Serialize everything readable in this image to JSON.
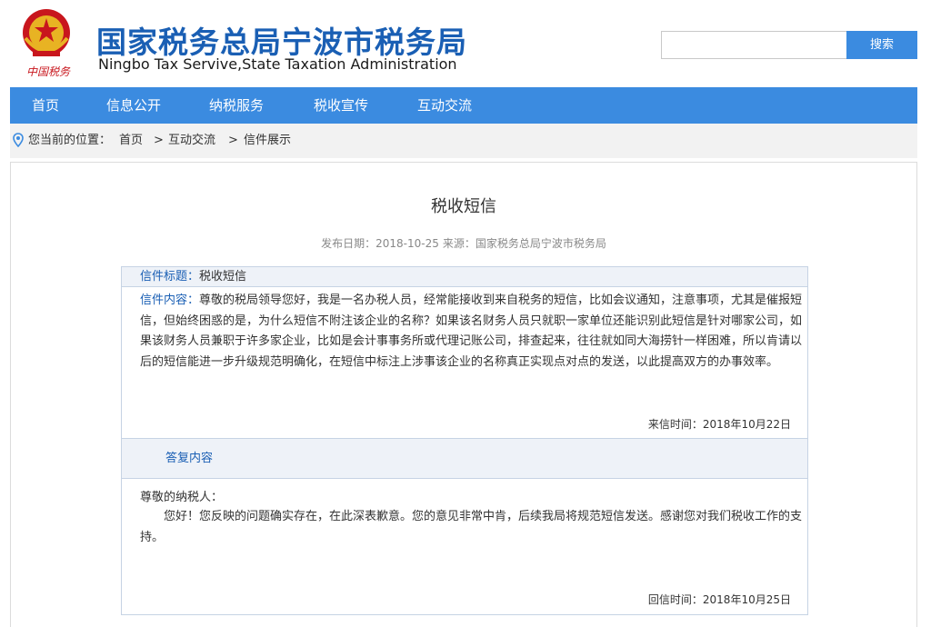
{
  "header": {
    "emblem_text": "中国税务",
    "site_title": "国家税务总局宁波市税务局",
    "site_subtitle": "Ningbo Tax Servive,State Taxation Administration",
    "search_placeholder": "",
    "search_button": "搜索"
  },
  "nav": {
    "items": [
      {
        "label": "首页"
      },
      {
        "label": "信息公开"
      },
      {
        "label": "纳税服务"
      },
      {
        "label": "税收宣传"
      },
      {
        "label": "互动交流"
      }
    ]
  },
  "breadcrumb": {
    "prefix": "您当前的位置：",
    "items": [
      "首页",
      "互动交流",
      "信件展示"
    ],
    "separator": ">"
  },
  "article": {
    "title": "税收短信",
    "publish_label": "发布日期：",
    "publish_date": "2018-10-25",
    "source_label": "来源：",
    "source": "国家税务总局宁波市税务局"
  },
  "letter": {
    "title_label": "信件标题：",
    "title_value": "税收短信",
    "content_label": "信件内容：",
    "content_value": "尊敬的税局领导您好，我是一名办税人员，经常能接收到来自税务的短信，比如会议通知，注意事项，尤其是催报短信，但始终困惑的是，为什么短信不附注该企业的名称？如果该名财务人员只就职一家单位还能识别此短信是针对哪家公司，如果该财务人员兼职于许多家企业，比如是会计事事务所或代理记账公司，排查起来，往往就如同大海捞针一样困难，所以肯请以后的短信能进一步升级规范明确化，在短信中标注上涉事该企业的名称真正实现点对点的发送，以此提高双方的办事效率。",
    "received_label": "来信时间：",
    "received_date": "2018年10月22日",
    "reply_header": "答复内容",
    "reply_greeting": "尊敬的纳税人：",
    "reply_text": "您好！您反映的问题确实存在，在此深表歉意。您的意见非常中肯，后续我局将规范短信发送。感谢您对我们税收工作的支持。",
    "reply_label": "回信时间：",
    "reply_date": "2018年10月25日"
  },
  "colors": {
    "brand_blue": "#1a5fb4",
    "nav_blue": "#3b8be0",
    "emblem_red": "#c8161d"
  }
}
